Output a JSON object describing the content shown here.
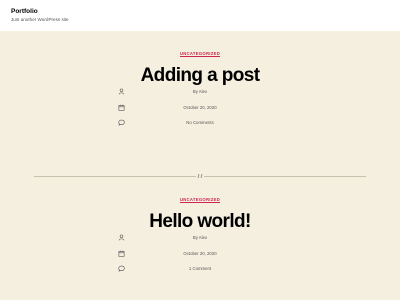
{
  "site": {
    "title": "Portfolio",
    "description": "Just another WordPress site"
  },
  "posts": [
    {
      "category": "UNCATEGORIZED",
      "title": "Adding a post",
      "author": "By Alex",
      "date": "October 20, 2020",
      "comments": "No Comments"
    },
    {
      "category": "UNCATEGORIZED",
      "title": "Hello world!",
      "author": "By Alex",
      "date": "October 20, 2020",
      "comments": "1 Comment"
    }
  ],
  "icons": {
    "author": "person-icon",
    "date": "calendar-icon",
    "comments": "comment-bubble-icon"
  },
  "colors": {
    "background": "#f5efe0",
    "header": "#ffffff",
    "accent": "#cd2653"
  }
}
